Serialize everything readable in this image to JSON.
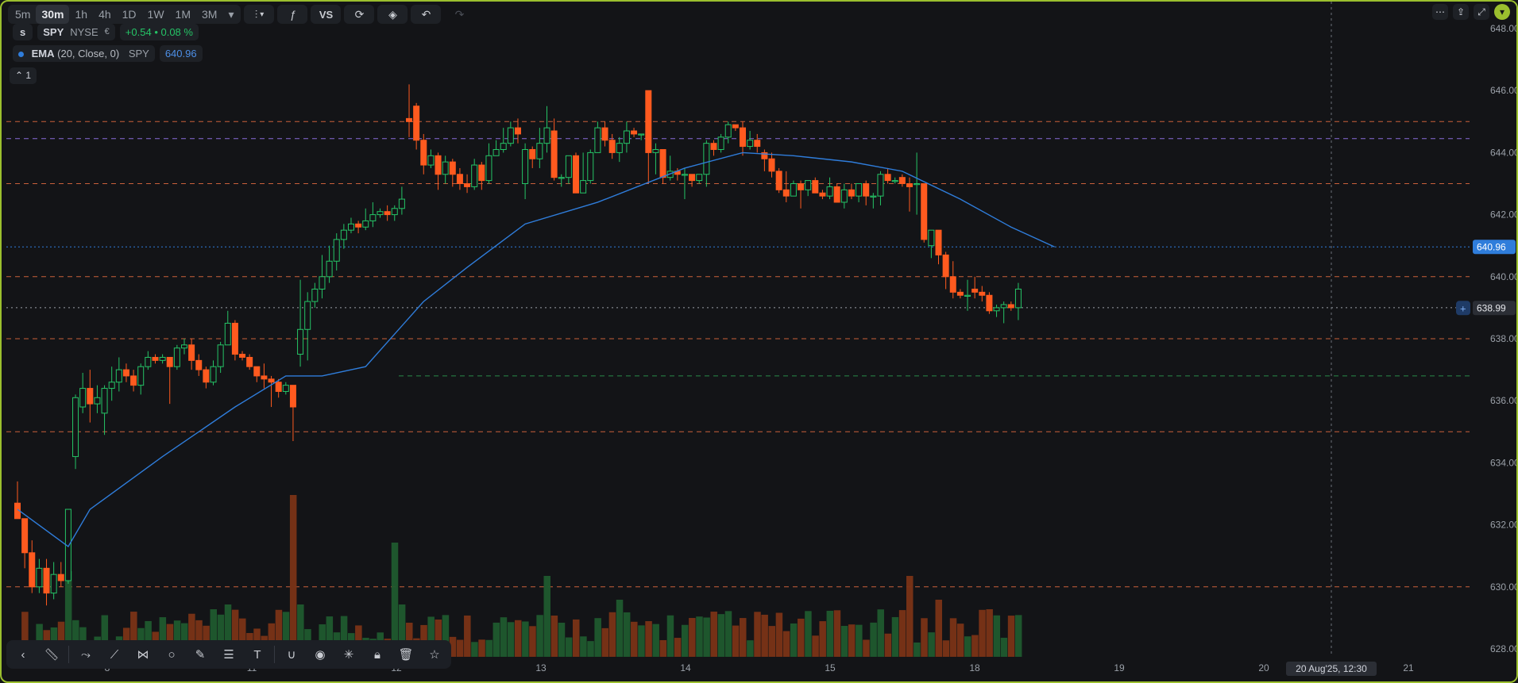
{
  "timeframes": [
    "5m",
    "30m",
    "1h",
    "4h",
    "1D",
    "1W",
    "1M",
    "3M"
  ],
  "active_timeframe": "30m",
  "toolbar": {
    "indicators_label": "VS"
  },
  "symbol": {
    "prefix": "s",
    "ticker": "SPY",
    "exchange": "NYSE",
    "change": "+0.54",
    "change_pct": "0.08 %",
    "change_color": "#25c466"
  },
  "indicator": {
    "name": "EMA",
    "params": "(20, Close, 0)",
    "source": "SPY",
    "value": "640.96",
    "color": "#2f7ddb"
  },
  "collapse_label": "1",
  "price_axis": {
    "labels": [
      "648.00",
      "646.00",
      "644.00",
      "642.00",
      "640.00",
      "638.00",
      "636.00",
      "634.00",
      "632.00",
      "630.00",
      "628.00"
    ],
    "ema_tag": "640.96",
    "last_tag": "638.99"
  },
  "time_axis": {
    "labels": [
      "8",
      "11",
      "12",
      "13",
      "14",
      "15",
      "18",
      "19",
      "20",
      "21"
    ],
    "cursor_label": "20 Aug'25, 12:30"
  },
  "colors": {
    "up": "#25c466",
    "down": "#ff5a1f",
    "ema": "#2f7ddb",
    "bg": "#131417",
    "frame": "#9bbf2e",
    "level": "#c9603a",
    "purple": "#8a6bd8",
    "green_level": "#2a8a48"
  },
  "levels": [
    645.0,
    644.45,
    643.0,
    640.0,
    639.0,
    638.0,
    636.8,
    635.0,
    630.0
  ],
  "chart_data": {
    "type": "candlestick",
    "y_range": [
      628,
      648
    ],
    "candles": [
      [
        632.7,
        632.2,
        632.2,
        633.4
      ],
      [
        632.2,
        631.1,
        630.6,
        632.2
      ],
      [
        631.1,
        630.0,
        629.8,
        631.5
      ],
      [
        630.0,
        630.6,
        629.8,
        630.9
      ],
      [
        630.6,
        629.8,
        629.4,
        630.9
      ],
      [
        629.8,
        630.4,
        629.6,
        630.8
      ],
      [
        630.4,
        630.2,
        630.0,
        630.8
      ],
      [
        630.2,
        632.5,
        630.1,
        632.5
      ],
      [
        634.2,
        636.1,
        633.8,
        636.2
      ],
      [
        635.8,
        636.4,
        635.6,
        636.9
      ],
      [
        636.4,
        635.9,
        635.3,
        637.0
      ],
      [
        635.9,
        636.1,
        635.6,
        636.5
      ],
      [
        635.6,
        636.4,
        634.9,
        636.5
      ],
      [
        636.4,
        636.6,
        636.0,
        637.1
      ],
      [
        636.6,
        637.0,
        636.3,
        637.4
      ],
      [
        637.0,
        636.8,
        636.6,
        637.2
      ],
      [
        636.8,
        636.5,
        636.3,
        637.0
      ],
      [
        636.5,
        637.1,
        636.2,
        637.2
      ],
      [
        637.1,
        637.4,
        637.0,
        637.6
      ],
      [
        637.4,
        637.3,
        637.2,
        637.5
      ],
      [
        637.3,
        637.4,
        637.2,
        637.5
      ],
      [
        637.4,
        637.1,
        635.9,
        637.4
      ],
      [
        637.1,
        637.7,
        637.0,
        637.8
      ],
      [
        637.7,
        637.8,
        637.5,
        638.0
      ],
      [
        637.8,
        637.3,
        637.0,
        638.0
      ],
      [
        637.3,
        637.0,
        636.8,
        637.5
      ],
      [
        637.0,
        636.6,
        636.4,
        637.1
      ],
      [
        636.6,
        637.1,
        636.5,
        637.3
      ],
      [
        637.1,
        637.8,
        636.9,
        637.9
      ],
      [
        637.8,
        638.5,
        637.8,
        638.9
      ],
      [
        638.5,
        637.5,
        637.3,
        638.6
      ],
      [
        637.5,
        637.4,
        637.3,
        637.6
      ],
      [
        637.4,
        637.1,
        637.0,
        637.5
      ],
      [
        637.1,
        636.8,
        636.6,
        637.1
      ],
      [
        636.8,
        636.7,
        636.4,
        637.2
      ],
      [
        636.7,
        636.6,
        635.8,
        636.8
      ],
      [
        636.6,
        636.3,
        636.1,
        636.7
      ],
      [
        636.3,
        636.5,
        636.2,
        636.6
      ],
      [
        636.5,
        635.8,
        634.7,
        636.5
      ],
      [
        637.5,
        638.3,
        637.1,
        639.9
      ],
      [
        638.3,
        639.2,
        637.3,
        639.5
      ],
      [
        639.2,
        639.6,
        639.0,
        639.8
      ],
      [
        639.6,
        640.0,
        639.3,
        640.7
      ],
      [
        640.0,
        640.5,
        639.8,
        641.0
      ],
      [
        640.5,
        641.2,
        640.2,
        641.4
      ],
      [
        641.2,
        641.5,
        640.9,
        641.7
      ],
      [
        641.5,
        641.7,
        641.4,
        641.9
      ],
      [
        641.7,
        641.6,
        641.4,
        641.8
      ],
      [
        641.6,
        641.8,
        641.5,
        642.2
      ],
      [
        641.8,
        642.0,
        641.6,
        642.4
      ],
      [
        642.0,
        642.1,
        641.9,
        642.2
      ],
      [
        642.1,
        642.0,
        641.8,
        642.3
      ],
      [
        642.0,
        642.2,
        641.8,
        642.3
      ],
      [
        642.2,
        642.5,
        642.0,
        642.9
      ],
      [
        645.1,
        645.0,
        644.5,
        646.2
      ],
      [
        645.5,
        644.4,
        644.1,
        645.6
      ],
      [
        644.4,
        643.6,
        643.3,
        644.6
      ],
      [
        643.6,
        643.9,
        643.5,
        644.1
      ],
      [
        643.9,
        643.3,
        642.8,
        644.0
      ],
      [
        643.3,
        643.7,
        643.0,
        643.9
      ],
      [
        643.7,
        643.3,
        642.9,
        643.8
      ],
      [
        643.3,
        643.0,
        642.8,
        643.5
      ],
      [
        643.0,
        642.9,
        642.7,
        643.3
      ],
      [
        642.9,
        643.6,
        642.8,
        643.8
      ],
      [
        643.6,
        643.1,
        642.8,
        643.7
      ],
      [
        643.1,
        643.9,
        643.0,
        644.3
      ],
      [
        643.9,
        644.1,
        643.9,
        644.4
      ],
      [
        644.1,
        644.3,
        644.0,
        644.8
      ],
      [
        644.3,
        644.8,
        644.2,
        645.0
      ],
      [
        644.8,
        644.6,
        644.3,
        645.1
      ],
      [
        643.0,
        644.1,
        642.5,
        644.3
      ],
      [
        644.1,
        643.8,
        643.5,
        644.2
      ],
      [
        643.8,
        644.3,
        643.5,
        644.8
      ],
      [
        644.3,
        644.8,
        644.0,
        645.5
      ],
      [
        644.7,
        643.2,
        643.1,
        645.1
      ],
      [
        643.2,
        643.2,
        642.9,
        643.3
      ],
      [
        643.2,
        643.9,
        643.0,
        643.9
      ],
      [
        643.9,
        642.7,
        642.9,
        644.0
      ],
      [
        642.7,
        643.1,
        643.0,
        644.0
      ],
      [
        643.1,
        644.0,
        643.0,
        644.1
      ],
      [
        644.0,
        644.8,
        644.0,
        645.0
      ],
      [
        644.8,
        644.4,
        644.2,
        645.0
      ],
      [
        644.4,
        644.0,
        643.8,
        644.6
      ],
      [
        644.0,
        644.3,
        643.7,
        644.5
      ],
      [
        644.3,
        644.7,
        644.0,
        645.0
      ],
      [
        644.7,
        644.6,
        644.5,
        644.8
      ],
      [
        644.6,
        644.6,
        644.4,
        644.6
      ],
      [
        646.0,
        644.0,
        643.0,
        646.0
      ],
      [
        644.0,
        644.1,
        643.3,
        644.3
      ],
      [
        644.1,
        643.2,
        643.0,
        644.1
      ],
      [
        643.2,
        643.4,
        643.1,
        643.9
      ],
      [
        643.4,
        643.3,
        643.1,
        643.5
      ],
      [
        643.3,
        643.3,
        642.5,
        643.5
      ],
      [
        643.3,
        643.1,
        642.9,
        643.2
      ],
      [
        643.1,
        643.3,
        643.0,
        643.3
      ],
      [
        643.3,
        644.3,
        642.9,
        644.4
      ],
      [
        644.3,
        644.1,
        643.9,
        644.4
      ],
      [
        644.1,
        644.5,
        644.0,
        644.6
      ],
      [
        644.5,
        644.9,
        644.3,
        645.0
      ],
      [
        644.9,
        644.8,
        644.7,
        644.9
      ],
      [
        644.8,
        644.2,
        643.9,
        645.0
      ],
      [
        644.2,
        644.4,
        644.1,
        644.7
      ],
      [
        644.4,
        644.2,
        644.0,
        644.6
      ],
      [
        644.0,
        643.8,
        643.4,
        644.1
      ],
      [
        643.8,
        643.4,
        643.2,
        644.0
      ],
      [
        643.4,
        642.8,
        642.7,
        643.5
      ],
      [
        642.8,
        642.6,
        642.4,
        643.4
      ],
      [
        642.6,
        643.0,
        642.6,
        643.1
      ],
      [
        643.0,
        642.8,
        642.2,
        643.1
      ],
      [
        642.8,
        643.1,
        642.6,
        643.1
      ],
      [
        643.1,
        642.7,
        642.7,
        643.2
      ],
      [
        642.7,
        642.6,
        642.5,
        642.8
      ],
      [
        642.6,
        642.9,
        642.5,
        643.2
      ],
      [
        642.9,
        642.4,
        642.4,
        643.0
      ],
      [
        642.4,
        642.8,
        642.2,
        643.0
      ],
      [
        642.8,
        642.6,
        642.5,
        643.0
      ],
      [
        642.6,
        643.0,
        642.4,
        643.0
      ],
      [
        643.0,
        642.6,
        642.3,
        643.1
      ],
      [
        642.6,
        642.6,
        642.2,
        642.7
      ],
      [
        642.6,
        643.3,
        642.3,
        643.4
      ],
      [
        643.3,
        643.1,
        643.0,
        643.5
      ],
      [
        643.1,
        643.1,
        643.0,
        643.2
      ],
      [
        643.2,
        643.0,
        642.9,
        643.3
      ],
      [
        643.0,
        642.9,
        642.1,
        643.2
      ],
      [
        643.0,
        643.0,
        642.0,
        644.0
      ],
      [
        643.0,
        641.2,
        641.1,
        643.0
      ],
      [
        641.0,
        641.5,
        640.6,
        641.5
      ],
      [
        641.5,
        640.7,
        640.4,
        641.5
      ],
      [
        640.7,
        640.0,
        639.6,
        640.8
      ],
      [
        640.0,
        639.5,
        639.3,
        640.5
      ],
      [
        639.5,
        639.4,
        639.3,
        639.6
      ],
      [
        639.4,
        639.4,
        638.9,
        639.9
      ],
      [
        639.6,
        639.5,
        639.3,
        640.0
      ],
      [
        639.5,
        639.4,
        639.2,
        639.7
      ],
      [
        639.4,
        638.9,
        638.8,
        639.5
      ],
      [
        638.9,
        639.0,
        638.7,
        639.1
      ],
      [
        639.0,
        639.1,
        638.5,
        639.2
      ],
      [
        639.1,
        639.0,
        638.9,
        639.2
      ],
      [
        639.0,
        639.6,
        638.6,
        639.8
      ]
    ],
    "ema": [
      [
        0,
        632.5
      ],
      [
        7,
        631.3
      ],
      [
        10,
        632.5
      ],
      [
        20,
        634.2
      ],
      [
        30,
        635.8
      ],
      [
        37,
        636.8
      ],
      [
        42,
        636.8
      ],
      [
        48,
        637.1
      ],
      [
        56,
        639.2
      ],
      [
        62,
        640.3
      ],
      [
        70,
        641.7
      ],
      [
        80,
        642.4
      ],
      [
        92,
        643.5
      ],
      [
        100,
        644.0
      ],
      [
        107,
        643.9
      ],
      [
        115,
        643.7
      ],
      [
        122,
        643.4
      ],
      [
        130,
        642.5
      ],
      [
        137,
        641.6
      ],
      [
        143,
        640.96
      ]
    ]
  }
}
